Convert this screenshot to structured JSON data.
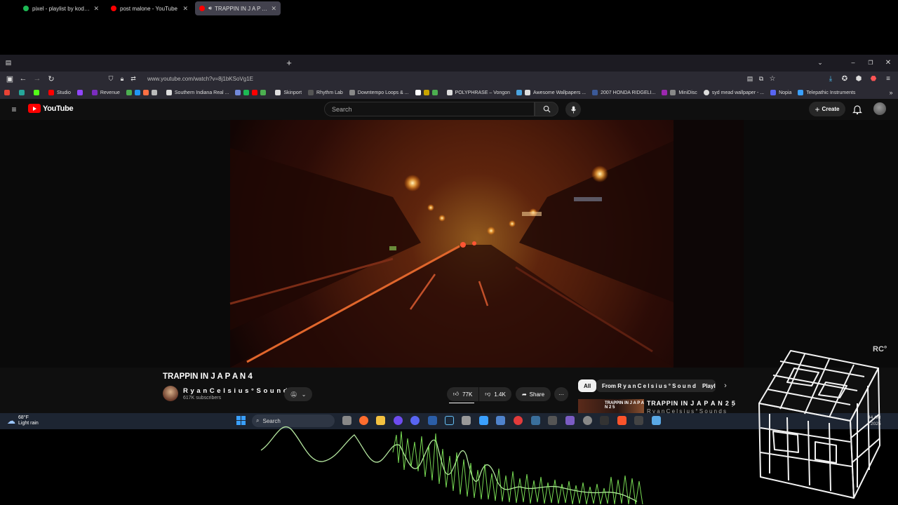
{
  "browser": {
    "tabs": [
      {
        "title": "pixel - playlist by kodachrome",
        "favicon_color": "#1db954",
        "active": false
      },
      {
        "title": "post malone - YouTube",
        "favicon_color": "#ff0000",
        "active": false
      },
      {
        "title": "TRAPPIN IN J A P A N 4",
        "favicon_color": "#ff0000",
        "active": true
      }
    ],
    "url": "www.youtube.com/watch?v=8j1bKSoVg1E",
    "bookmarks": [
      {
        "label": "Studio",
        "color": "#ff0000"
      },
      {
        "label": "Revenue",
        "color": "#7b2cbf"
      },
      {
        "label": "Southern Indiana Real ...",
        "color": "#dddddd"
      },
      {
        "label": "Skinport",
        "color": "#dddddd"
      },
      {
        "label": "Rhythm Lab",
        "color": "#555555"
      },
      {
        "label": "Downtempo Loops & ...",
        "color": "#888888"
      },
      {
        "label": "POLYPHRASE – Vongon",
        "color": "#dddddd"
      },
      {
        "label": "Awesome Wallpapers ...",
        "color": "#4aa3df"
      },
      {
        "label": "2007 HONDA RIDGELI...",
        "color": "#3b5998"
      },
      {
        "label": "MiniDisc",
        "color": "#888888"
      },
      {
        "label": "syd mead wallpaper - ...",
        "color": "#dddddd"
      },
      {
        "label": "Nopia",
        "color": "#5865f2"
      },
      {
        "label": "Telepathic Instruments",
        "color": "#3aa0ff"
      }
    ]
  },
  "youtube": {
    "logo_text": "YouTube",
    "search_placeholder": "Search",
    "create_label": "Create",
    "video_watermark": "RC°",
    "title": "TRAPPIN IN J A P A N 4",
    "channel": "R y a n C e l s i u s ° S o u n d s",
    "subscribers": "617K subscribers",
    "likes": "77K",
    "dislikes": "1.4K",
    "share_label": "Share",
    "more_label": "···",
    "chips": [
      "All",
      "From R y a n C e l s i u s ° S o u n d s",
      "Playl"
    ],
    "recommendation_title": "TRAPPIN IN J A P A N 2 5",
    "recommendation_channel": "R y a n C e l s i u s ° S o u n d s"
  },
  "taskbar": {
    "weather_temp": "68°F",
    "weather_desc": "Light rain",
    "search_label": "Search",
    "time": "44 AM",
    "date": "2025"
  },
  "colors": {
    "yt_red": "#ff0000",
    "yt_bg": "#0f0f0f",
    "waveform": "#9cff7a",
    "taskbar": "#1d2532"
  },
  "icons": [
    "menu-icon",
    "youtube-logo-icon",
    "search-icon",
    "mic-icon",
    "bell-icon",
    "like-icon",
    "dislike-icon",
    "share-icon",
    "windows-start-icon"
  ]
}
